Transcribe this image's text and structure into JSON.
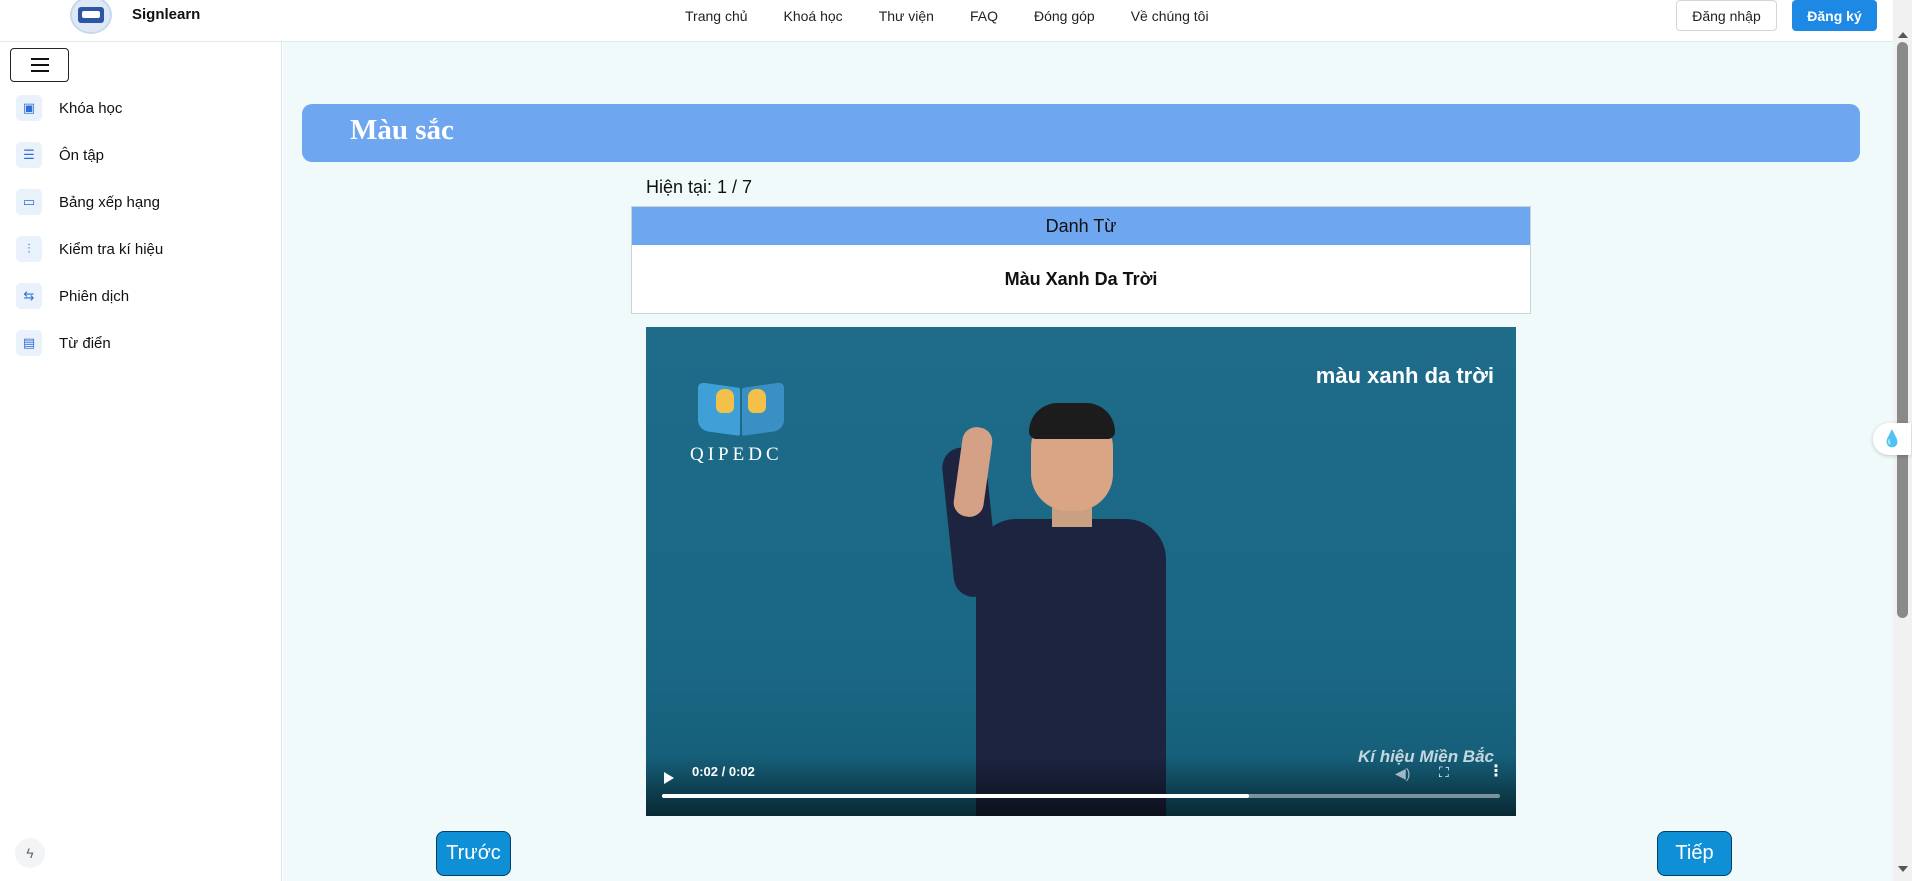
{
  "header": {
    "brand": "Signlearn",
    "nav": [
      "Trang chủ",
      "Khoá học",
      "Thư viện",
      "FAQ",
      "Đóng góp",
      "Về chúng tôi"
    ],
    "login_label": "Đăng nhập",
    "signup_label": "Đăng ký"
  },
  "sidebar": {
    "items": [
      {
        "label": "Khóa học",
        "icon": "course-icon"
      },
      {
        "label": "Ôn tập",
        "icon": "review-icon"
      },
      {
        "label": "Bảng xếp hạng",
        "icon": "leaderboard-icon"
      },
      {
        "label": "Kiểm tra kí hiệu",
        "icon": "check-sign-icon"
      },
      {
        "label": "Phiên dịch",
        "icon": "translate-icon"
      },
      {
        "label": "Từ điển",
        "icon": "dictionary-icon"
      }
    ]
  },
  "main": {
    "title": "Màu sắc",
    "progress": "Hiện tại: 1 / 7",
    "card": {
      "category": "Danh Từ",
      "word": "Màu Xanh Da Trời"
    },
    "video": {
      "caption": "màu xanh da trời",
      "logo_text": "QIPEDC",
      "watermark": "Kí hiệu Miền Bắc",
      "time": "0:02 / 0:02",
      "progress_fraction": 0.7
    },
    "prev_label": "Trước",
    "next_label": "Tiếp"
  },
  "colors": {
    "accent": "#6fa6f0",
    "primary_button": "#1e88e5",
    "nav_button": "#0e8fd6",
    "video_bg": "#1e6c8a"
  }
}
